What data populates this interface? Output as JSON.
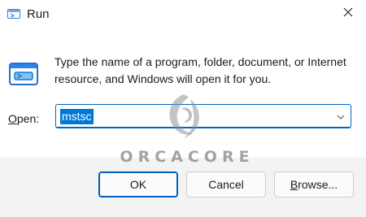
{
  "window": {
    "title": "Run",
    "icon": "run-icon",
    "close_icon": "close-icon"
  },
  "description": "Type the name of a program, folder, document, or Internet resource, and Windows will open it for you.",
  "open_field": {
    "label_mnemonic": "O",
    "label_rest": "pen:",
    "value": "mstsc",
    "dropdown_icon": "chevron-down-icon"
  },
  "watermark": {
    "text": "ORCACORE"
  },
  "buttons": {
    "ok": "OK",
    "cancel": "Cancel",
    "browse_mnemonic": "B",
    "browse_rest": "rowse..."
  },
  "colors": {
    "accent": "#0067c0",
    "selection": "#0078d7",
    "dialog_bg": "#ffffff",
    "footer_bg": "#f3f3f3"
  }
}
